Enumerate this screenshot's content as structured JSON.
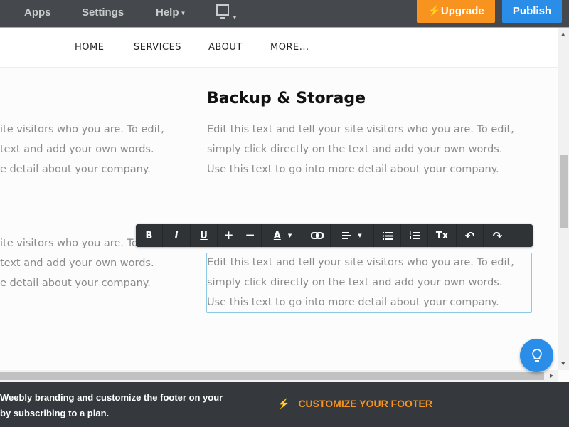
{
  "topbar": {
    "apps": "Apps",
    "settings": "Settings",
    "help": "Help",
    "upgrade": "Upgrade",
    "publish": "Publish",
    "colors": {
      "upgrade": "#f7931e",
      "publish": "#2a8ee8"
    }
  },
  "sitenav": [
    "HOME",
    "SERVICES",
    "ABOUT",
    "MORE..."
  ],
  "section": {
    "heading": "Backup & Storage",
    "right_text_1": [
      "Edit this text and tell your site visitors who you are. To edit,",
      "simply click directly on the text and add your own words.",
      "Use this text to go into more detail about your company."
    ],
    "left_text_1": [
      "ite visitors who you are. To edit,",
      "text and add your own words.",
      "e detail about your company."
    ],
    "left_text_2": [
      "ite visitors who you are. To",
      "text and add your own words.",
      "e detail about your company."
    ],
    "right_text_2": [
      "Edit this text and tell your site visitors who you are. To edit,",
      "simply click directly on the text and add your own words.",
      "Use this text to go into more detail about your company."
    ]
  },
  "toolbar": {
    "bold": "B",
    "italic": "I",
    "underline": "U",
    "increase": "+",
    "decrease": "−",
    "color": "A",
    "clear": "Tx"
  },
  "footer": {
    "line1": "Weebly branding and customize the footer on your",
    "line2": "by subscribing to a plan.",
    "cta": "CUSTOMIZE YOUR FOOTER",
    "cta_color": "#f7931e"
  }
}
